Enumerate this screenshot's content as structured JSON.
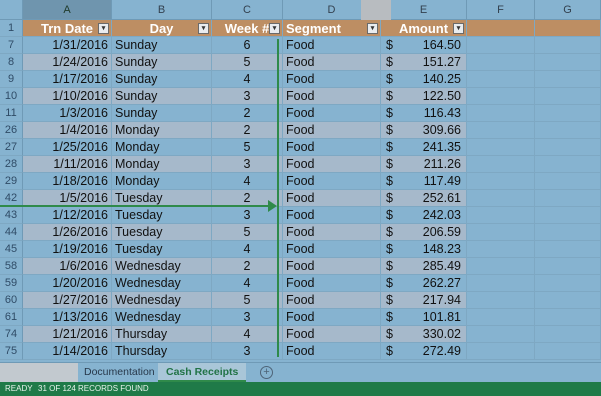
{
  "columns": [
    "A",
    "B",
    "C",
    "D",
    "E",
    "F",
    "G"
  ],
  "header_row": {
    "row_num": "1",
    "cells": [
      "Trn Date",
      "Day",
      "Week #",
      "Segment",
      "Amount"
    ]
  },
  "rows": [
    {
      "row_num": "7",
      "date": "1/31/2016",
      "day": "Sunday",
      "week": "6",
      "segment": "Food",
      "currency": "$",
      "amount": "164.50"
    },
    {
      "row_num": "8",
      "date": "1/24/2016",
      "day": "Sunday",
      "week": "5",
      "segment": "Food",
      "currency": "$",
      "amount": "151.27"
    },
    {
      "row_num": "9",
      "date": "1/17/2016",
      "day": "Sunday",
      "week": "4",
      "segment": "Food",
      "currency": "$",
      "amount": "140.25"
    },
    {
      "row_num": "10",
      "date": "1/10/2016",
      "day": "Sunday",
      "week": "3",
      "segment": "Food",
      "currency": "$",
      "amount": "122.50"
    },
    {
      "row_num": "11",
      "date": "1/3/2016",
      "day": "Sunday",
      "week": "2",
      "segment": "Food",
      "currency": "$",
      "amount": "116.43"
    },
    {
      "row_num": "26",
      "date": "1/4/2016",
      "day": "Monday",
      "week": "2",
      "segment": "Food",
      "currency": "$",
      "amount": "309.66"
    },
    {
      "row_num": "27",
      "date": "1/25/2016",
      "day": "Monday",
      "week": "5",
      "segment": "Food",
      "currency": "$",
      "amount": "241.35"
    },
    {
      "row_num": "28",
      "date": "1/11/2016",
      "day": "Monday",
      "week": "3",
      "segment": "Food",
      "currency": "$",
      "amount": "211.26"
    },
    {
      "row_num": "29",
      "date": "1/18/2016",
      "day": "Monday",
      "week": "4",
      "segment": "Food",
      "currency": "$",
      "amount": "117.49"
    },
    {
      "row_num": "42",
      "date": "1/5/2016",
      "day": "Tuesday",
      "week": "2",
      "segment": "Food",
      "currency": "$",
      "amount": "252.61"
    },
    {
      "row_num": "43",
      "date": "1/12/2016",
      "day": "Tuesday",
      "week": "3",
      "segment": "Food",
      "currency": "$",
      "amount": "242.03"
    },
    {
      "row_num": "44",
      "date": "1/26/2016",
      "day": "Tuesday",
      "week": "5",
      "segment": "Food",
      "currency": "$",
      "amount": "206.59"
    },
    {
      "row_num": "45",
      "date": "1/19/2016",
      "day": "Tuesday",
      "week": "4",
      "segment": "Food",
      "currency": "$",
      "amount": "148.23"
    },
    {
      "row_num": "58",
      "date": "1/6/2016",
      "day": "Wednesday",
      "week": "2",
      "segment": "Food",
      "currency": "$",
      "amount": "285.49"
    },
    {
      "row_num": "59",
      "date": "1/20/2016",
      "day": "Wednesday",
      "week": "4",
      "segment": "Food",
      "currency": "$",
      "amount": "262.27"
    },
    {
      "row_num": "60",
      "date": "1/27/2016",
      "day": "Wednesday",
      "week": "5",
      "segment": "Food",
      "currency": "$",
      "amount": "217.94"
    },
    {
      "row_num": "61",
      "date": "1/13/2016",
      "day": "Wednesday",
      "week": "3",
      "segment": "Food",
      "currency": "$",
      "amount": "101.81"
    },
    {
      "row_num": "74",
      "date": "1/21/2016",
      "day": "Thursday",
      "week": "4",
      "segment": "Food",
      "currency": "$",
      "amount": "330.02"
    },
    {
      "row_num": "75",
      "date": "1/14/2016",
      "day": "Thursday",
      "week": "3",
      "segment": "Food",
      "currency": "$",
      "amount": "272.49"
    }
  ],
  "tabs": [
    "Documentation",
    "Cash Receipts"
  ],
  "active_tab": "Cash Receipts",
  "add_sheet_icon": "+",
  "status": {
    "mode": "READY",
    "records": "31 OF 124 RECORDS FOUND"
  },
  "colors": {
    "header_fill": "#bd8e63",
    "band_fill": "#a6b9cb",
    "annotation": "#2f8a4a",
    "status_bar": "#1f7a48"
  }
}
